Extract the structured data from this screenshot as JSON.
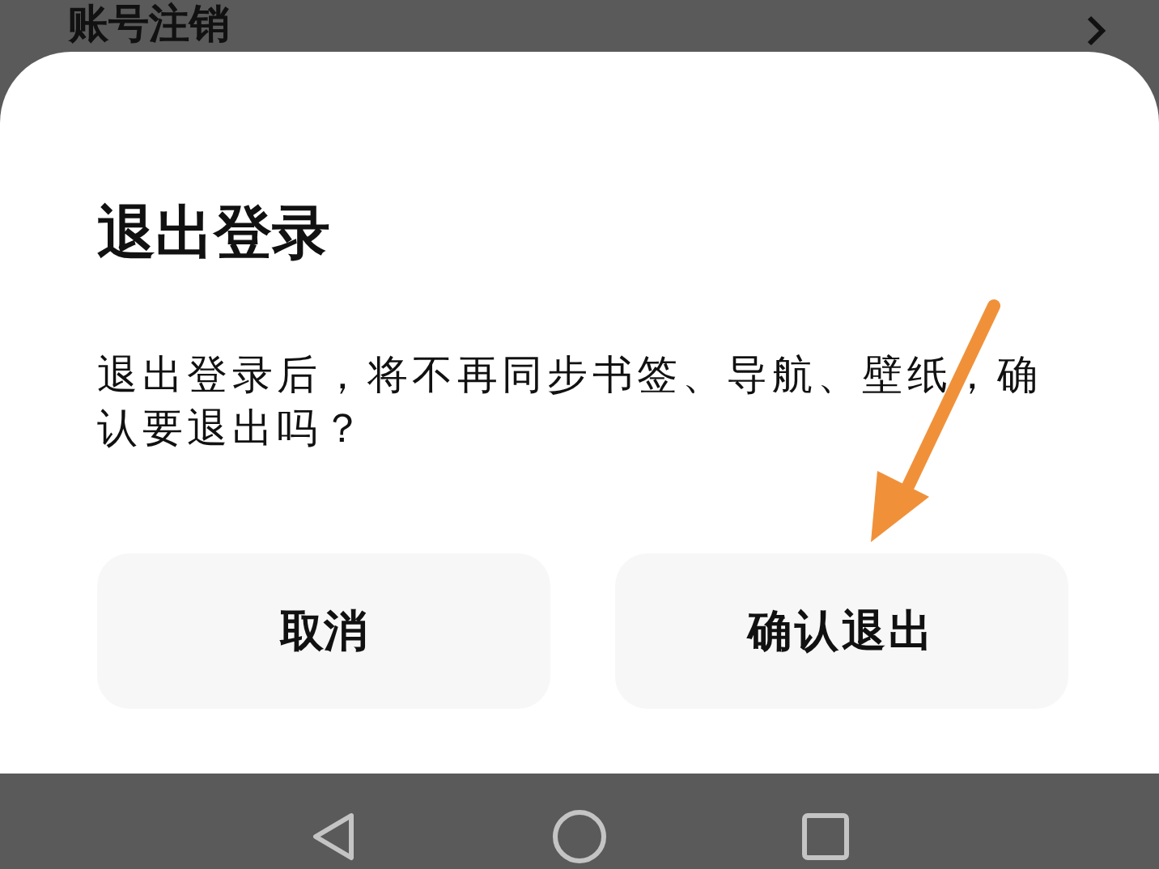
{
  "background_row": {
    "label": "账号注销"
  },
  "dialog": {
    "title": "退出登录",
    "message": "退出登录后，将不再同步书签、导航、壁纸，确认要退出吗？",
    "buttons": [
      {
        "label": "取消",
        "kind": "cancel"
      },
      {
        "label": "确认退出",
        "kind": "confirm"
      }
    ]
  },
  "annotation": {
    "kind": "arrow"
  }
}
